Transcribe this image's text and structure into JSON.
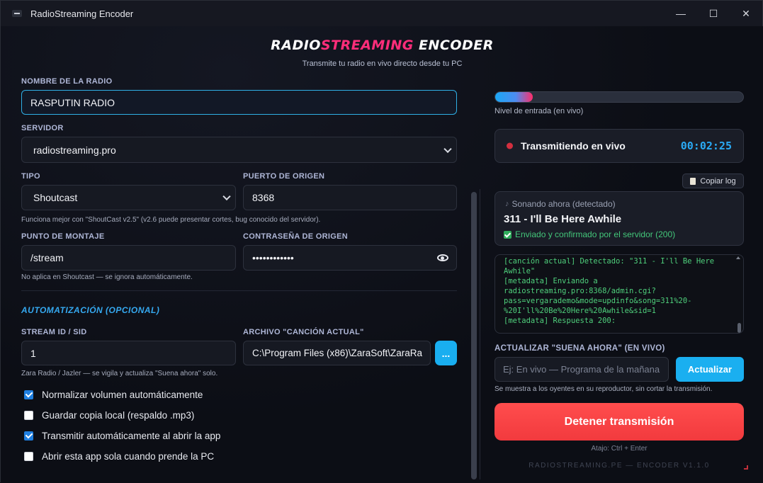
{
  "window": {
    "title": "RadioStreaming Encoder",
    "minimize_glyph": "—",
    "maximize_glyph": "☐",
    "close_glyph": "✕"
  },
  "brand": {
    "part1": "RADIO",
    "part2": "STREAMING",
    "part3": " ENCODER",
    "tagline": "Transmite tu radio en vivo directo desde tu PC"
  },
  "form": {
    "radio_name_label": "NOMBRE DE LA RADIO",
    "radio_name_value": "RASPUTIN RADIO",
    "server_label": "SERVIDOR",
    "server_value": "radiostreaming.pro",
    "type_label": "TIPO",
    "type_value": "Shoutcast",
    "port_label": "PUERTO DE ORIGEN",
    "port_value": "8368",
    "type_hint": "Funciona mejor con \"ShoutCast v2.5\" (v2.6 puede presentar cortes, bug conocido del servidor).",
    "mount_label": "PUNTO DE MONTAJE",
    "mount_value": "/stream",
    "password_label": "CONTRASEÑA DE ORIGEN",
    "password_value": "••••••••••••",
    "mount_hint": "No aplica en Shoutcast — se ignora automáticamente."
  },
  "automation": {
    "section_title": "AUTOMATIZACIÓN (OPCIONAL)",
    "sid_label": "STREAM ID / SID",
    "sid_value": "1",
    "file_label": "ARCHIVO \"CANCIÓN ACTUAL\"",
    "file_value": "C:\\Program Files (x86)\\ZaraSoft\\ZaraRa",
    "browse_label": "...",
    "hint": "Zara Radio / Jazler — se vigila y actualiza \"Suena ahora\" solo."
  },
  "options": [
    {
      "label": "Normalizar volumen automáticamente",
      "checked": true
    },
    {
      "label": "Guardar copia local (respaldo .mp3)",
      "checked": false
    },
    {
      "label": "Transmitir automáticamente al abrir la app",
      "checked": true
    },
    {
      "label": "Abrir esta app sola cuando prende la PC",
      "checked": false
    }
  ],
  "meter": {
    "level": 0.15,
    "label": "Nivel de entrada (en vivo)"
  },
  "status": {
    "text": "Transmitiendo en vivo",
    "timer": "00:02:25",
    "dot_color": "#d32f3f"
  },
  "log_button": {
    "label": "Copiar log",
    "icon": "clipboard-icon"
  },
  "now_playing": {
    "header": "Sonando ahora (detectado)",
    "song": "311 - I'll Be Here Awhile",
    "confirmation": "Enviado y confirmado por el servidor (200)"
  },
  "log": {
    "text": "[canción actual] Detectado: \"311 - I'll Be Here\nAwhile\"\n[metadata] Enviando a\nradiostreaming.pro:8368/admin.cgi?\npass=vergarademo&mode=updinfo&song=311%20-\n%20I'll%20Be%20Here%20Awhile&sid=1\n[metadata] Respuesta 200:"
  },
  "update": {
    "label": "ACTUALIZAR \"SUENA AHORA\" (EN VIVO)",
    "placeholder": "Ej: En vivo — Programa de la mañana",
    "button": "Actualizar",
    "hint": "Se muestra a los oyentes en su reproductor, sin cortar la transmisión."
  },
  "stop": {
    "button": "Detener transmisión",
    "shortcut": "Atajo: Ctrl + Enter"
  },
  "footer": "RADIOSTREAMING.PE — ENCODER V1.1.0",
  "colors": {
    "accent": "#19aef0",
    "pink": "#ff2d7a",
    "stop": "#f23a3e",
    "ok": "#43c77a"
  }
}
